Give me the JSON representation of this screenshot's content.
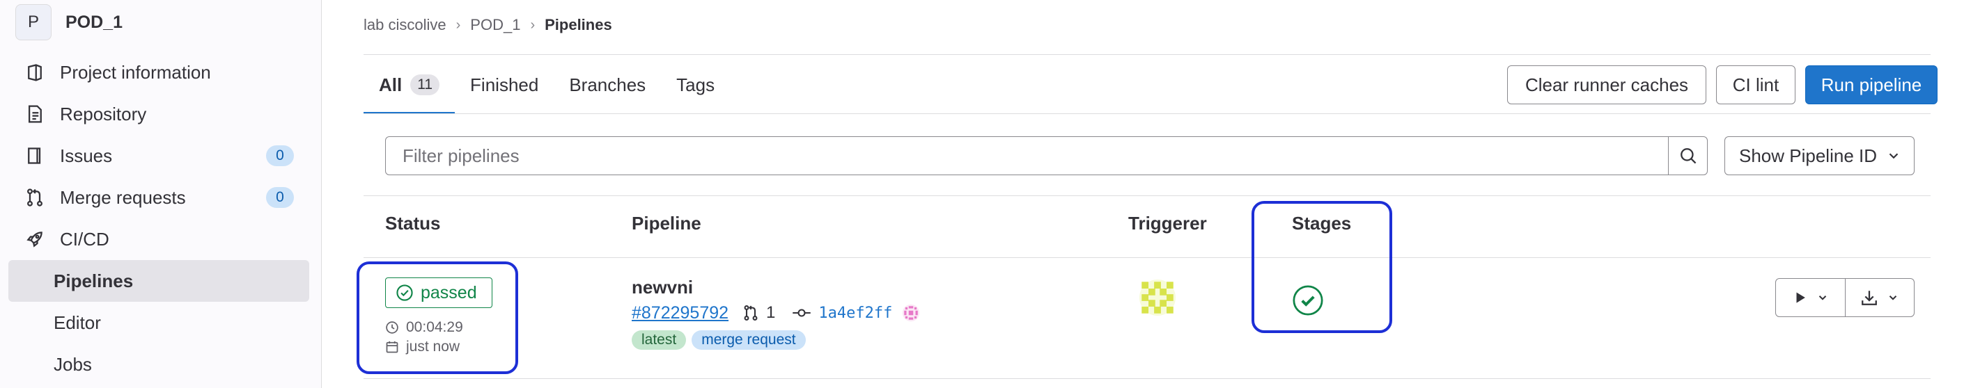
{
  "project": {
    "avatar_letter": "P",
    "name": "POD_1"
  },
  "sidebar": {
    "items": [
      {
        "label": "Project information",
        "icon": "project-information-icon"
      },
      {
        "label": "Repository",
        "icon": "repository-icon"
      },
      {
        "label": "Issues",
        "icon": "issues-icon",
        "count": "0"
      },
      {
        "label": "Merge requests",
        "icon": "merge-request-icon",
        "count": "0"
      },
      {
        "label": "CI/CD",
        "icon": "rocket-icon"
      },
      {
        "label": "Pipelines"
      },
      {
        "label": "Editor"
      },
      {
        "label": "Jobs"
      }
    ]
  },
  "breadcrumb": {
    "group": "lab ciscolive",
    "project": "POD_1",
    "current": "Pipelines",
    "separator": "›"
  },
  "tabs": [
    {
      "label": "All",
      "count": "11"
    },
    {
      "label": "Finished"
    },
    {
      "label": "Branches"
    },
    {
      "label": "Tags"
    }
  ],
  "toolbar": {
    "clear_caches": "Clear runner caches",
    "ci_lint": "CI lint",
    "run_pipeline": "Run pipeline"
  },
  "filter": {
    "placeholder": "Filter pipelines",
    "show_id_label": "Show Pipeline ID"
  },
  "table": {
    "headers": {
      "status": "Status",
      "pipeline": "Pipeline",
      "triggerer": "Triggerer",
      "stages": "Stages"
    },
    "rows": [
      {
        "status": "passed",
        "duration": "00:04:29",
        "finished": "just now",
        "title": "newvni",
        "id": "#872295792",
        "mr_count": "1",
        "sha": "1a4ef2ff",
        "badges": [
          "latest",
          "merge request"
        ]
      }
    ]
  },
  "colors": {
    "accent": "#1f75cb",
    "success": "#108548",
    "highlight": "#1d2fd6"
  }
}
